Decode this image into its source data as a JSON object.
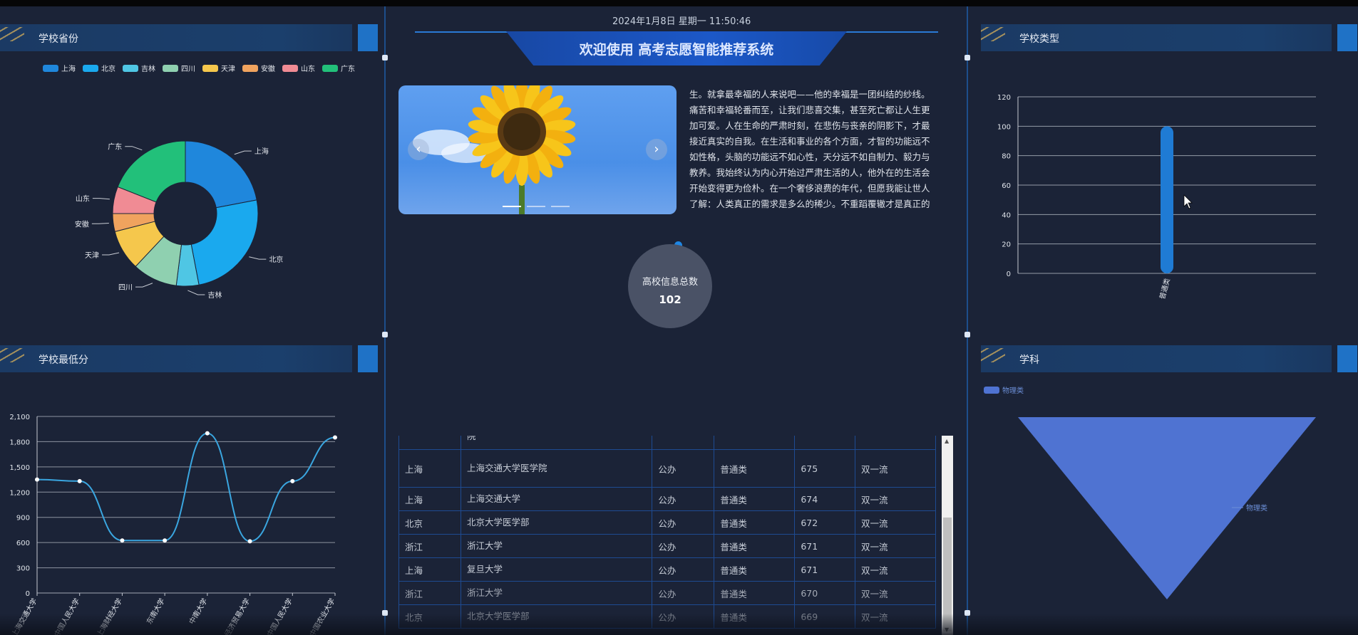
{
  "header": {
    "datetime": "2024年1月8日 星期一 11:50:46",
    "title": "欢迎使用 高考志愿智能推荐系统"
  },
  "panels": {
    "province_title": "学校省份",
    "type_title": "学校类型",
    "minscore_title": "学校最低分",
    "subject_title": "学科"
  },
  "colors": {
    "上海": "#1f87dc",
    "北京": "#1aa9ee",
    "吉林": "#4fc6e4",
    "四川": "#8fd0b0",
    "天津": "#f5c74c",
    "安徽": "#f0a35e",
    "山东": "#f08b94",
    "广东": "#22c07a",
    "line": "#3aa6e0",
    "bar": "#1f7bd4",
    "funnel": "#4f73d2"
  },
  "carousel": {
    "prev": "‹",
    "next": "›"
  },
  "article": {
    "text": "生。就拿最幸福的人来说吧——他的幸福是一团纠结的纱线。痛苦和幸福轮番而至，让我们悲喜交集，甚至死亡都让人生更加可爱。人在生命的严肃时刻，在悲伤与丧亲的阴影下，才最接近真实的自我。在生活和事业的各个方面，才智的功能远不如性格，头脑的功能远不如心性，天分远不如自制力、毅力与教养。我始终认为内心开始过严肃生活的人，他外在的生活会开始变得更为俭朴。在一个奢侈浪费的年代，但愿我能让世人了解：人类真正的需求是多么的稀少。不重蹈覆辙才是真正的"
  },
  "counter": {
    "label": "高校信息总数",
    "value": "102"
  },
  "table": {
    "rows": [
      [
        "",
        "院",
        "",
        "",
        "",
        ""
      ],
      [
        "上海",
        "上海交通大学医学院",
        "公办",
        "普通类",
        "675",
        "双一流"
      ],
      [
        "上海",
        "上海交通大学",
        "公办",
        "普通类",
        "674",
        "双一流"
      ],
      [
        "北京",
        "北京大学医学部",
        "公办",
        "普通类",
        "672",
        "双一流"
      ],
      [
        "浙江",
        "浙江大学",
        "公办",
        "普通类",
        "671",
        "双一流"
      ],
      [
        "上海",
        "复旦大学",
        "公办",
        "普通类",
        "671",
        "双一流"
      ],
      [
        "浙江",
        "浙江大学",
        "公办",
        "普通类",
        "670",
        "双一流"
      ],
      [
        "北京",
        "北京大学医学部",
        "公办",
        "普通类",
        "669",
        "双一流"
      ]
    ]
  },
  "chart_data": [
    {
      "type": "pie",
      "title": "学校省份",
      "categories": [
        "上海",
        "北京",
        "吉林",
        "四川",
        "天津",
        "安徽",
        "山东",
        "广东"
      ],
      "values": [
        22,
        25,
        5,
        10,
        9,
        4,
        6,
        19
      ],
      "legend": "top"
    },
    {
      "type": "bar",
      "title": "学校类型",
      "categories": [
        "普通类"
      ],
      "values": [
        100
      ],
      "ylim": [
        0,
        120
      ],
      "yticks": [
        "0",
        "20",
        "40",
        "60",
        "80",
        "100",
        "120"
      ],
      "grid": true
    },
    {
      "type": "line",
      "title": "学校最低分",
      "categories": [
        "上海交通大学",
        "中国人民大学",
        "上海财经大学",
        "东南大学",
        "中南大学",
        "对外经济贸易大学",
        "中国人民大学",
        "中国农业大学"
      ],
      "values": [
        1350,
        1330,
        625,
        625,
        1900,
        615,
        1330,
        1850
      ],
      "ylim": [
        0,
        2100
      ],
      "yticks": [
        "0",
        "300",
        "600",
        "900",
        "1,200",
        "1,500",
        "1,800",
        "2,100"
      ],
      "grid": true
    },
    {
      "type": "funnel",
      "title": "学科",
      "series": [
        {
          "name": "物理类",
          "values": [
            100
          ]
        }
      ],
      "legend": "top-left"
    }
  ]
}
